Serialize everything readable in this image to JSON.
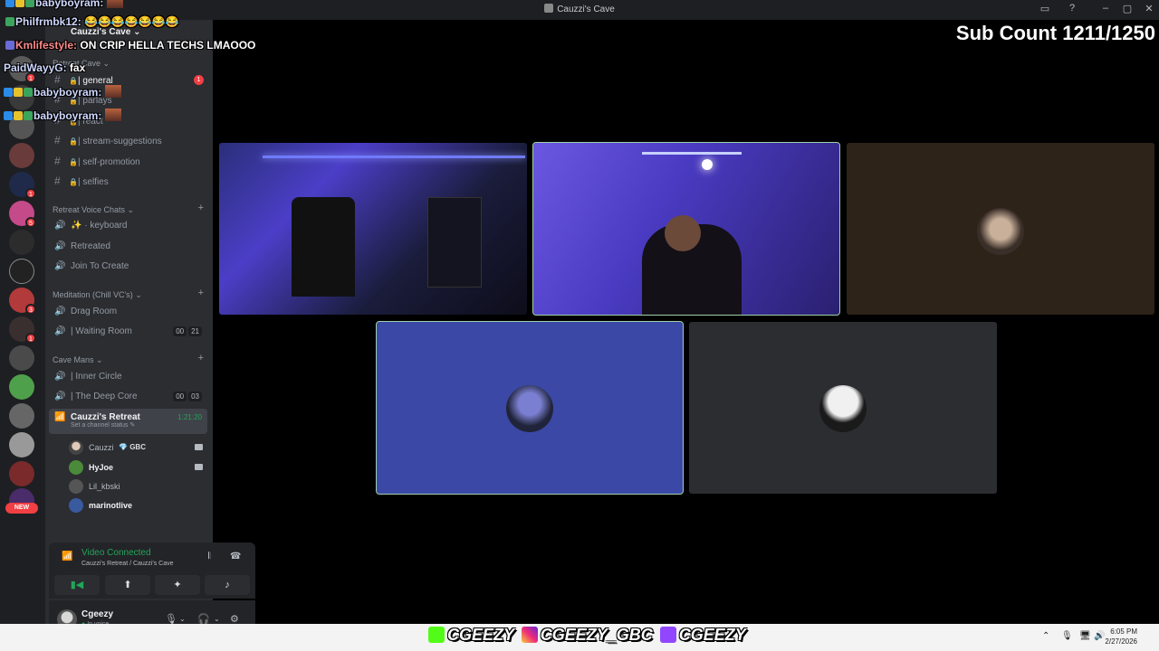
{
  "window": {
    "title": "Cauzzi's Cave",
    "controls": [
      "▭",
      "?",
      "–",
      "▢",
      "✕"
    ]
  },
  "stream_overlay": {
    "sub_count": "Sub Count 1211/1250",
    "chat": [
      {
        "user": "babyboyram:",
        "msg": ""
      },
      {
        "user": "Philfrmbk12:",
        "msg": "😂😂😂😂😂😂😂"
      },
      {
        "user": "Kmlifestyle:",
        "msg": "ON CRIP HELLA TECHS LMAOOO"
      },
      {
        "user": "PaidWayyG:",
        "msg": "fax"
      },
      {
        "user": "babyboyram:",
        "msg": ""
      },
      {
        "user": "babyboyram:",
        "msg": ""
      }
    ],
    "brand_handles": [
      "CGEEZY",
      "CGEEZY_GBC",
      "CGEEZY"
    ]
  },
  "server": {
    "name": "Cauzzi's Cave",
    "categories": [
      {
        "label": "Retreat Cave"
      },
      {
        "label": "Retreat Voice Chats"
      },
      {
        "label": "Meditation (Chill VC's)"
      },
      {
        "label": "Cave Mans"
      }
    ],
    "text_channels": [
      {
        "label": "| general",
        "unread": "1"
      },
      {
        "label": "| parlays"
      },
      {
        "label": "| react"
      },
      {
        "label": "| stream-suggestions"
      },
      {
        "label": "| self-promotion"
      },
      {
        "label": "| selfies"
      }
    ],
    "voice_channels_a": [
      {
        "label": "✨ · keyboard"
      },
      {
        "label": "Retreated"
      },
      {
        "label": "Join To Create"
      }
    ],
    "voice_channels_b": [
      {
        "label": "Drag Room"
      },
      {
        "label": "| Waiting Room",
        "counts": [
          "00",
          "21"
        ]
      }
    ],
    "voice_channels_c": [
      {
        "label": "| Inner Circle"
      },
      {
        "label": "| The Deep Core",
        "counts": [
          "00",
          "03"
        ]
      }
    ],
    "active_channel": {
      "label": "Cauzzi's Retreat",
      "timer": "1:21:20",
      "status_prompt": "Set a channel status"
    },
    "voice_users": [
      {
        "name": "Cauzzi",
        "tag": "GBC"
      },
      {
        "name": "HyJoe"
      },
      {
        "name": "Lil_kbski"
      },
      {
        "name": "marinotlive"
      }
    ],
    "server_badges": [
      "1",
      "1",
      "1",
      "5",
      "3",
      "1"
    ],
    "new_label": "NEW"
  },
  "voice_connection": {
    "status": "Video Connected",
    "location": "Cauzzi's Retreat / Cauzzi's Cave"
  },
  "user": {
    "name": "Cgeezy",
    "status": "In voice"
  },
  "taskbar": {
    "time": "6:05 PM",
    "date": "2/27/2026"
  },
  "colors": {
    "discord_dark": "#1e1f22",
    "panel": "#2b2d31",
    "connected_green": "#23a55a",
    "notification_red": "#f23f43",
    "speaking_tile": "#3b48a6"
  }
}
